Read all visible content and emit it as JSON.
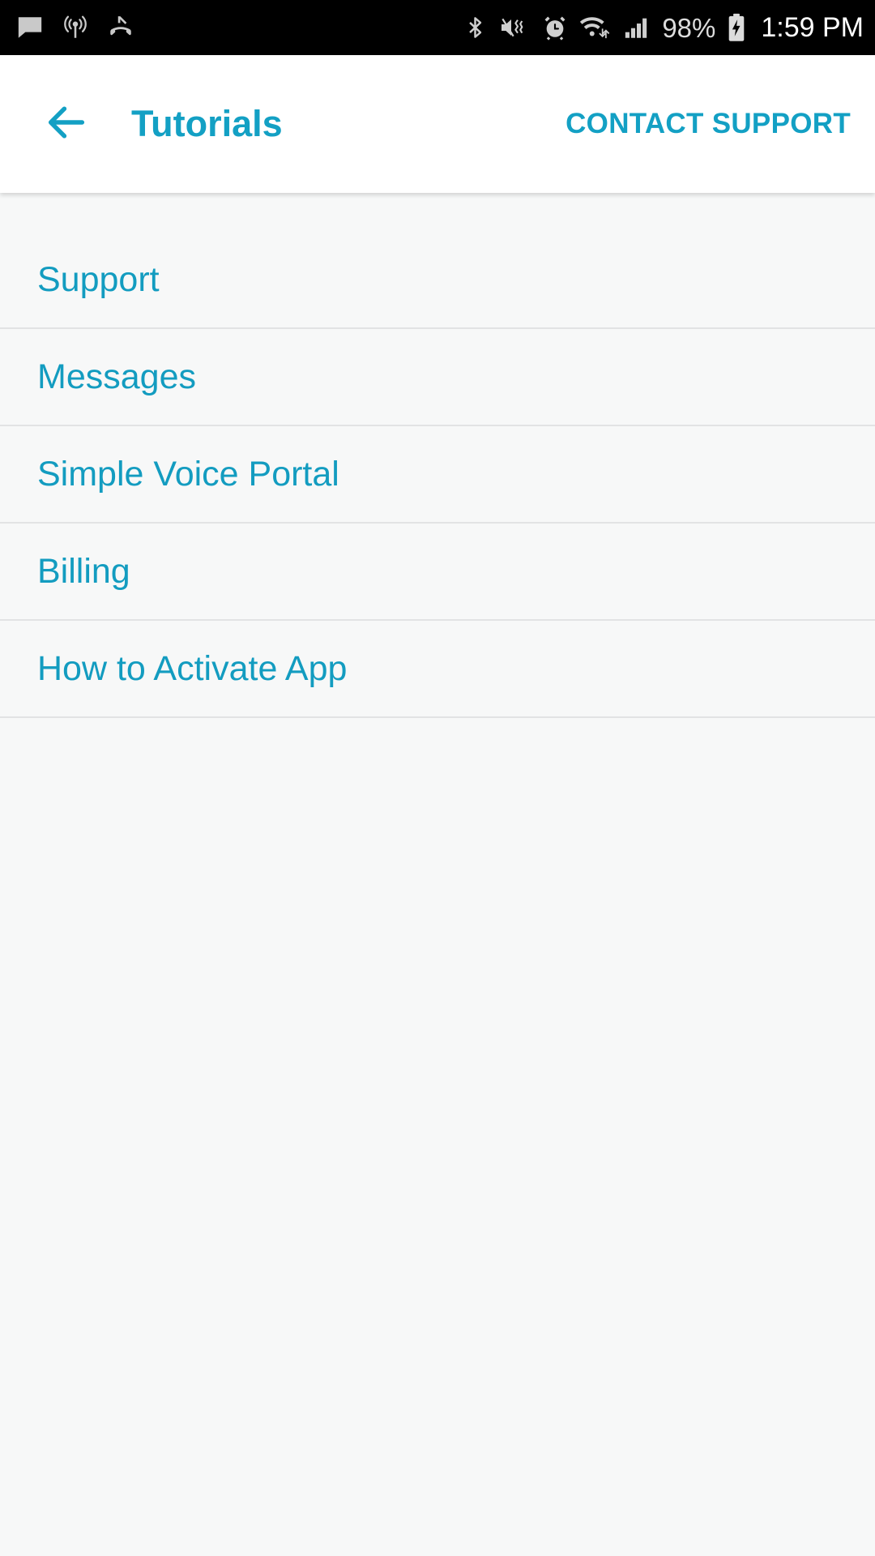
{
  "status_bar": {
    "left_icons": [
      {
        "name": "message-icon"
      },
      {
        "name": "cast-broadcast-icon"
      },
      {
        "name": "missed-call-icon"
      }
    ],
    "right_icons": [
      {
        "name": "bluetooth-icon"
      },
      {
        "name": "mute-vibrate-icon"
      },
      {
        "name": "alarm-clock-icon"
      },
      {
        "name": "wifi-icon"
      },
      {
        "name": "cellular-signal-icon"
      },
      {
        "name": "battery-charging-icon"
      }
    ],
    "battery_percent": "98%",
    "time": "1:59 PM"
  },
  "app_bar": {
    "back_icon": "arrow-left-icon",
    "title": "Tutorials",
    "action_label": "CONTACT SUPPORT"
  },
  "list": {
    "items": [
      {
        "label": "Support"
      },
      {
        "label": "Messages"
      },
      {
        "label": "Simple Voice Portal"
      },
      {
        "label": "Billing"
      },
      {
        "label": "How to Activate App"
      }
    ]
  },
  "colors": {
    "accent": "#13a0c4",
    "list_text": "#139cc0",
    "background": "#f7f8f8",
    "app_bar_bg": "#ffffff",
    "status_bar_bg": "#000000",
    "divider": "#e2e3e4"
  }
}
